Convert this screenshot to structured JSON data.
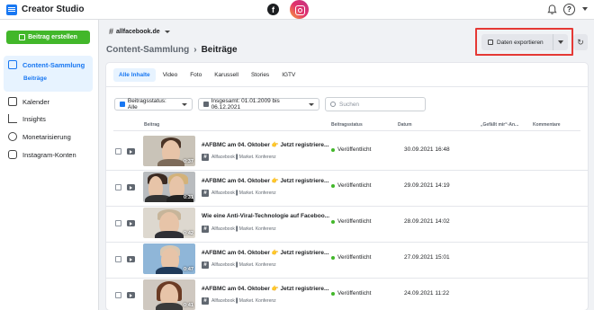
{
  "app": {
    "title": "Creator Studio"
  },
  "colors": {
    "accent": "#1877f2",
    "create_button": "#42b72a",
    "published_dot": "#42b72a",
    "highlight": "#e53935"
  },
  "sidebar": {
    "create_label": "Beitrag erstellen",
    "items": [
      {
        "label": "Content-Sammlung",
        "icon": "content-library-icon",
        "active": true
      },
      {
        "label": "Kalender",
        "icon": "calendar-icon"
      },
      {
        "label": "Insights",
        "icon": "insights-icon"
      },
      {
        "label": "Monetarisierung",
        "icon": "monetization-icon"
      },
      {
        "label": "Instagram-Konten",
        "icon": "instagram-accounts-icon"
      }
    ],
    "sub_item": "Beiträge"
  },
  "account": {
    "name": "allfacebook.de"
  },
  "breadcrumb": {
    "parent": "Content-Sammlung",
    "current": "Beiträge"
  },
  "export": {
    "label": "Daten exportieren"
  },
  "tabs": [
    "Alle Inhalte",
    "Video",
    "Foto",
    "Karussell",
    "Stories",
    "IGTV"
  ],
  "filters": {
    "status": "Beitragsstatus: Alle",
    "date_range": "Insgesamt: 01.01.2009 bis 06.12.2021",
    "search_placeholder": "Suchen"
  },
  "table": {
    "columns": [
      "Beitrag",
      "Beitragsstatus",
      "Datum",
      "„Gefällt mir“-An...",
      "Kommentare"
    ],
    "rows": [
      {
        "title": "#AFBMC am 04. Oktober 👉 Jetzt registriere...",
        "account": "Allfacebook ▌Market. Konferenz",
        "status": "Veröffentlicht",
        "date": "30.09.2021 16:48",
        "duration": "0:37"
      },
      {
        "title": "#AFBMC am 04. Oktober 👉 Jetzt registriere...",
        "account": "Allfacebook ▌Market. Konferenz",
        "status": "Veröffentlicht",
        "date": "29.09.2021 14:19",
        "duration": "0:31"
      },
      {
        "title": "Wie eine Anti-Viral-Technologie auf Faceboo...",
        "account": "Allfacebook ▌Market. Konferenz",
        "status": "Veröffentlicht",
        "date": "28.09.2021 14:02",
        "duration": "0:42"
      },
      {
        "title": "#AFBMC am 04. Oktober 👉 Jetzt registriere...",
        "account": "Allfacebook ▌Market. Konferenz",
        "status": "Veröffentlicht",
        "date": "27.09.2021 15:01",
        "duration": "0:47"
      },
      {
        "title": "#AFBMC am 04. Oktober 👉 Jetzt registriere...",
        "account": "Allfacebook ▌Market. Konferenz",
        "status": "Veröffentlicht",
        "date": "24.09.2021 11:22",
        "duration": "0:41"
      }
    ]
  }
}
